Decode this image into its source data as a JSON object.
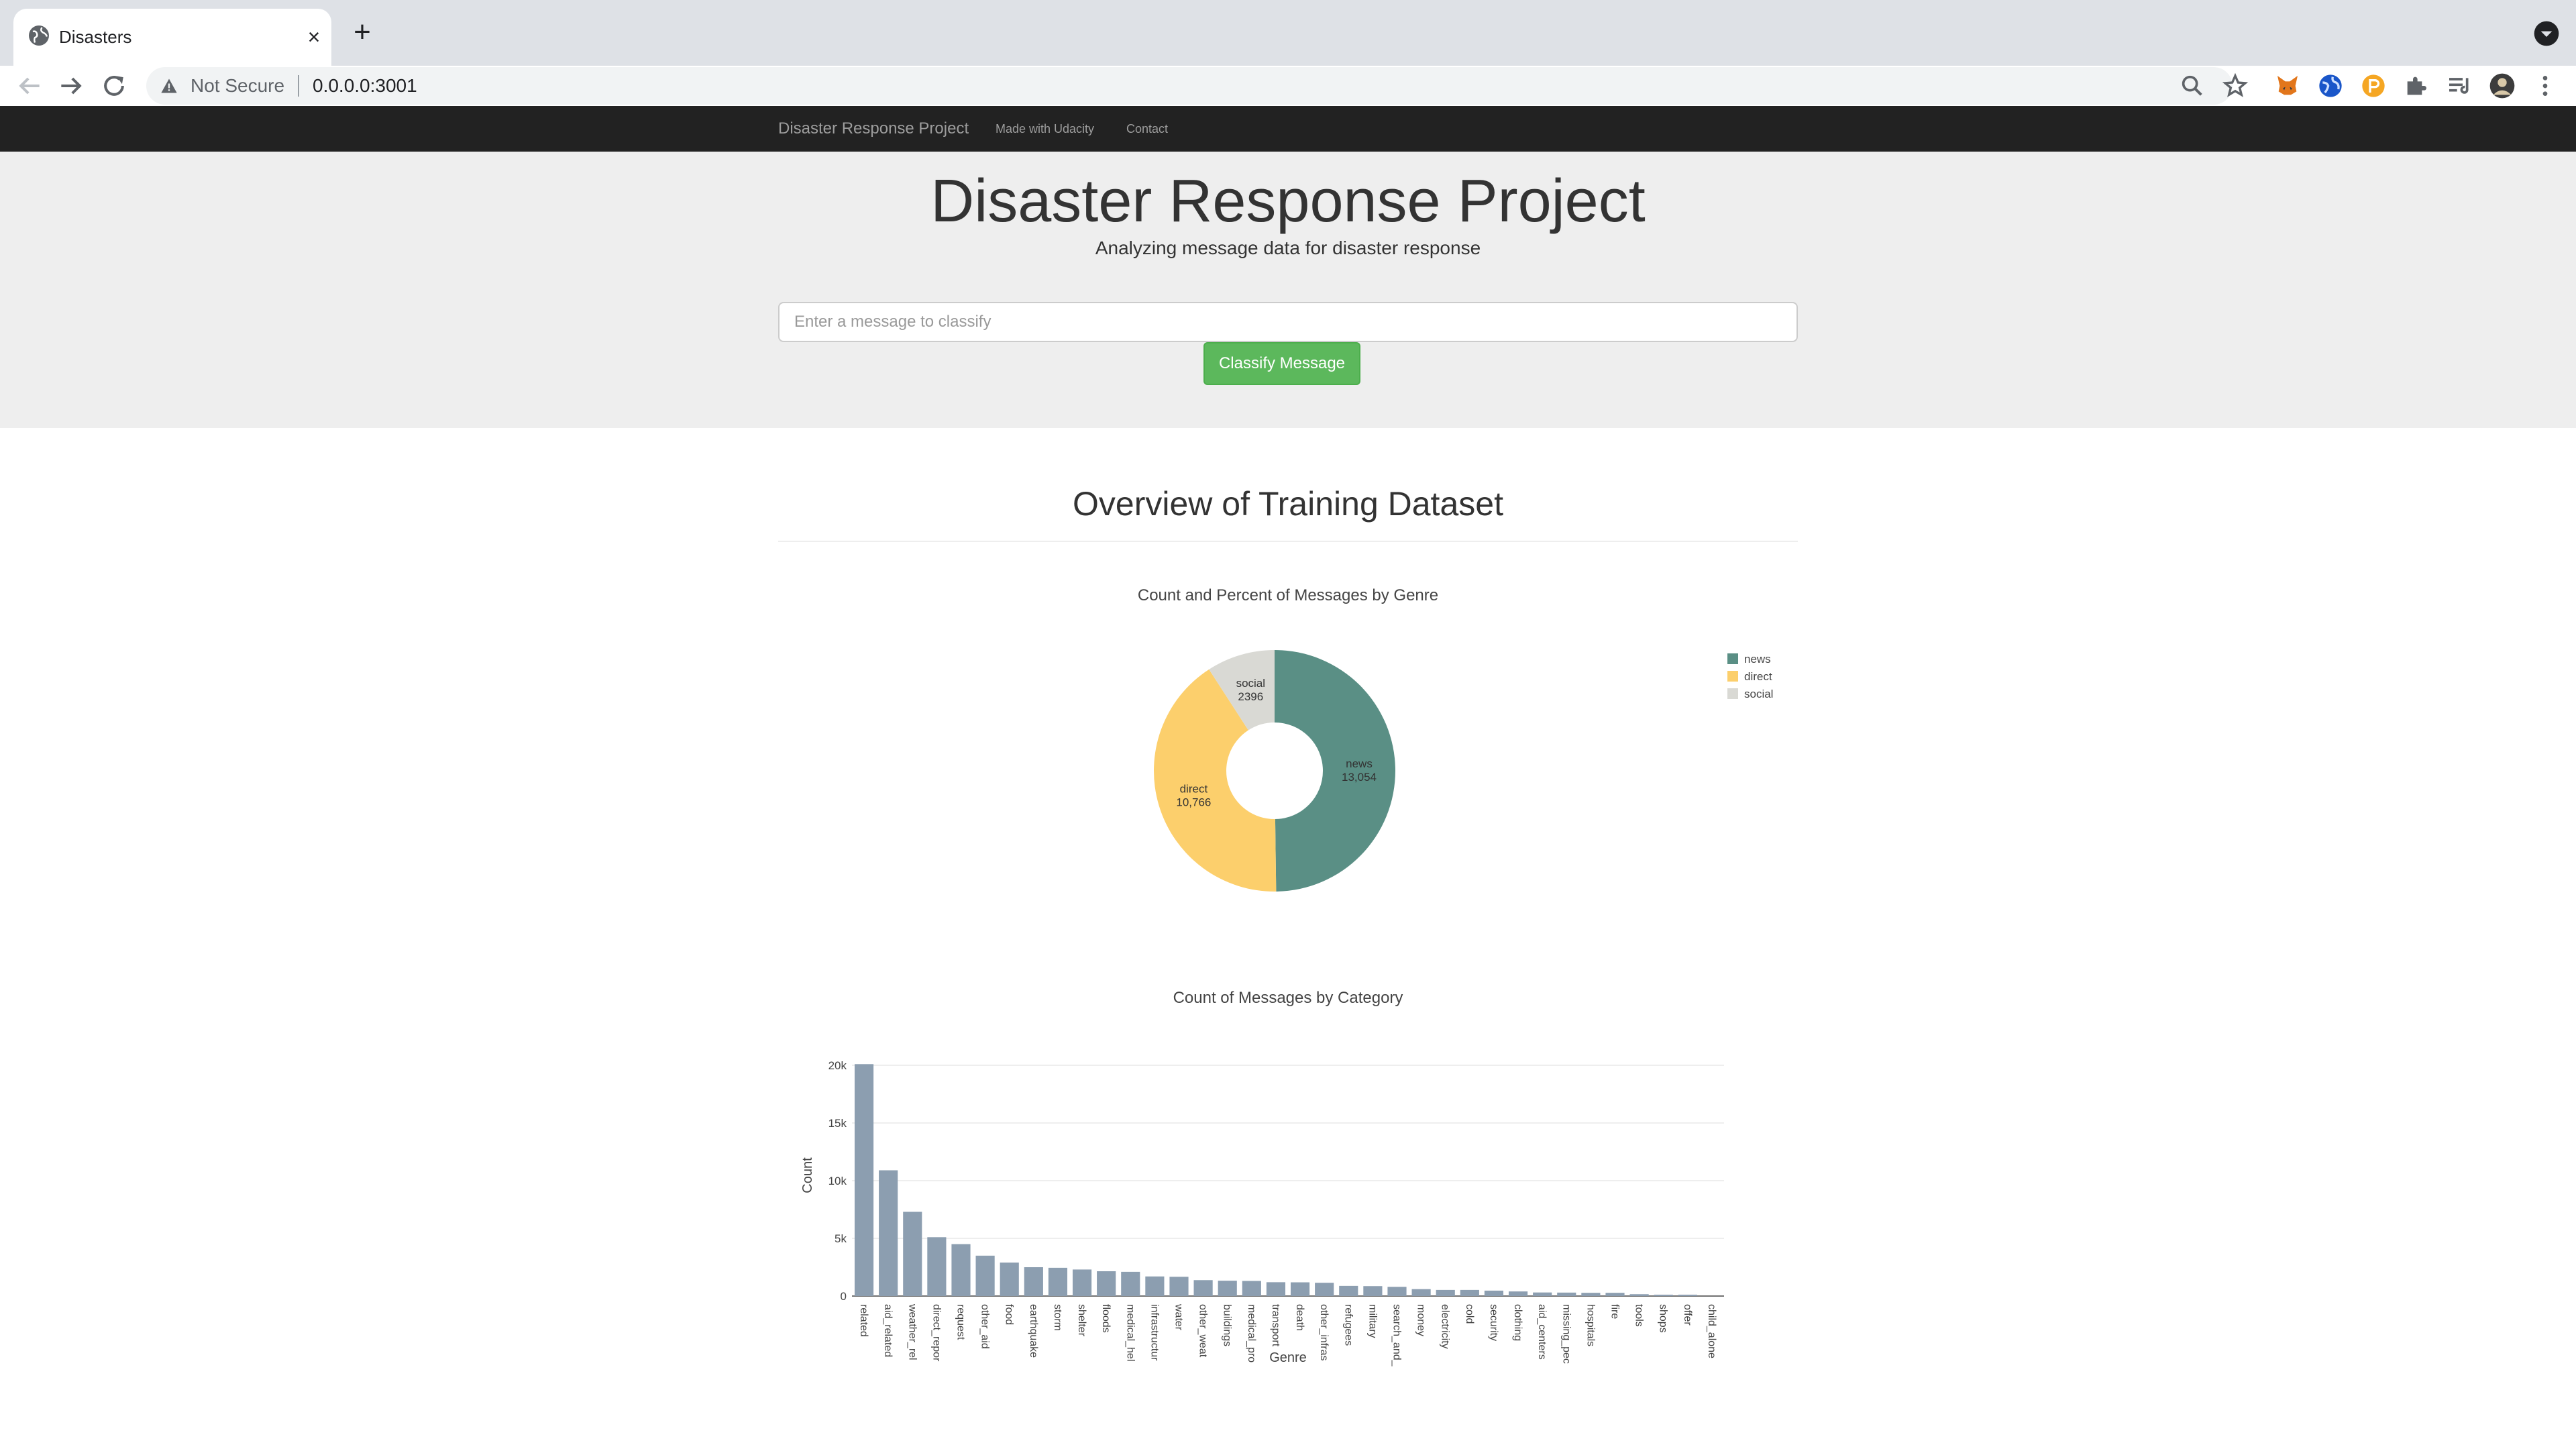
{
  "browser": {
    "tab_title": "Disasters",
    "tab_close": "×",
    "new_tab": "+",
    "security_label": "Not Secure",
    "url": "0.0.0.0:3001",
    "icons": [
      "back-icon",
      "forward-icon",
      "reload-icon",
      "zoom-icon",
      "bookmark-star-icon",
      "metamask-fox-icon",
      "globe-extension-icon",
      "coin-extension-icon",
      "extensions-puzzle-icon",
      "reading-list-icon",
      "profile-avatar",
      "menu-kebab-icon"
    ]
  },
  "navbar": {
    "brand": "Disaster Response Project",
    "links": [
      "Made with Udacity",
      "Contact"
    ]
  },
  "jumbotron": {
    "title": "Disaster Response Project",
    "subtitle": "Analyzing message data for disaster response",
    "input_placeholder": "Enter a message to classify",
    "button_label": "Classify Message"
  },
  "section": {
    "title": "Overview of Training Dataset"
  },
  "colors": {
    "news": "#5a8f85",
    "direct": "#fccf6c",
    "social": "#d9d9d4",
    "bar": "#8c9eb0",
    "classify_button": "#5cb85c",
    "navbar": "#222222",
    "jumbotron": "#eeeeee"
  },
  "chart_data": [
    {
      "type": "pie",
      "title": "Count and Percent of Messages by Genre",
      "hole": true,
      "legend_position": "top-right",
      "labels": [
        "news",
        "direct",
        "social"
      ],
      "values": [
        13054,
        10766,
        2396
      ],
      "slice_labels": [
        {
          "name": "news",
          "text": "13,054"
        },
        {
          "name": "direct",
          "text": "10,766"
        },
        {
          "name": "social",
          "text": "2396"
        }
      ]
    },
    {
      "type": "bar",
      "title": "Count of Messages by Category",
      "xlabel": "Genre",
      "ylabel": "Count",
      "ylim": [
        0,
        20000
      ],
      "yticks": [
        0,
        5000,
        10000,
        15000,
        20000
      ],
      "ytick_labels": [
        "0",
        "5k",
        "10k",
        "15k",
        "20k"
      ],
      "grid": true,
      "categories": [
        "related",
        "aid_related",
        "weather_rel",
        "direct_repor",
        "request",
        "other_aid",
        "food",
        "earthquake",
        "storm",
        "shelter",
        "floods",
        "medical_hel",
        "infrastructur",
        "water",
        "other_weat",
        "buildings",
        "medical_pro",
        "transport",
        "death",
        "other_infras",
        "refugees",
        "military",
        "search_and_",
        "money",
        "electricity",
        "cold",
        "security",
        "clothing",
        "aid_centers",
        "missing_pec",
        "hospitals",
        "fire",
        "tools",
        "shops",
        "offer",
        "child_alone"
      ],
      "values": [
        20100,
        10900,
        7300,
        5100,
        4500,
        3500,
        2900,
        2500,
        2450,
        2300,
        2150,
        2100,
        1700,
        1670,
        1380,
        1330,
        1310,
        1200,
        1190,
        1150,
        880,
        860,
        800,
        600,
        530,
        530,
        470,
        400,
        310,
        300,
        280,
        280,
        160,
        120,
        120,
        0
      ]
    }
  ]
}
